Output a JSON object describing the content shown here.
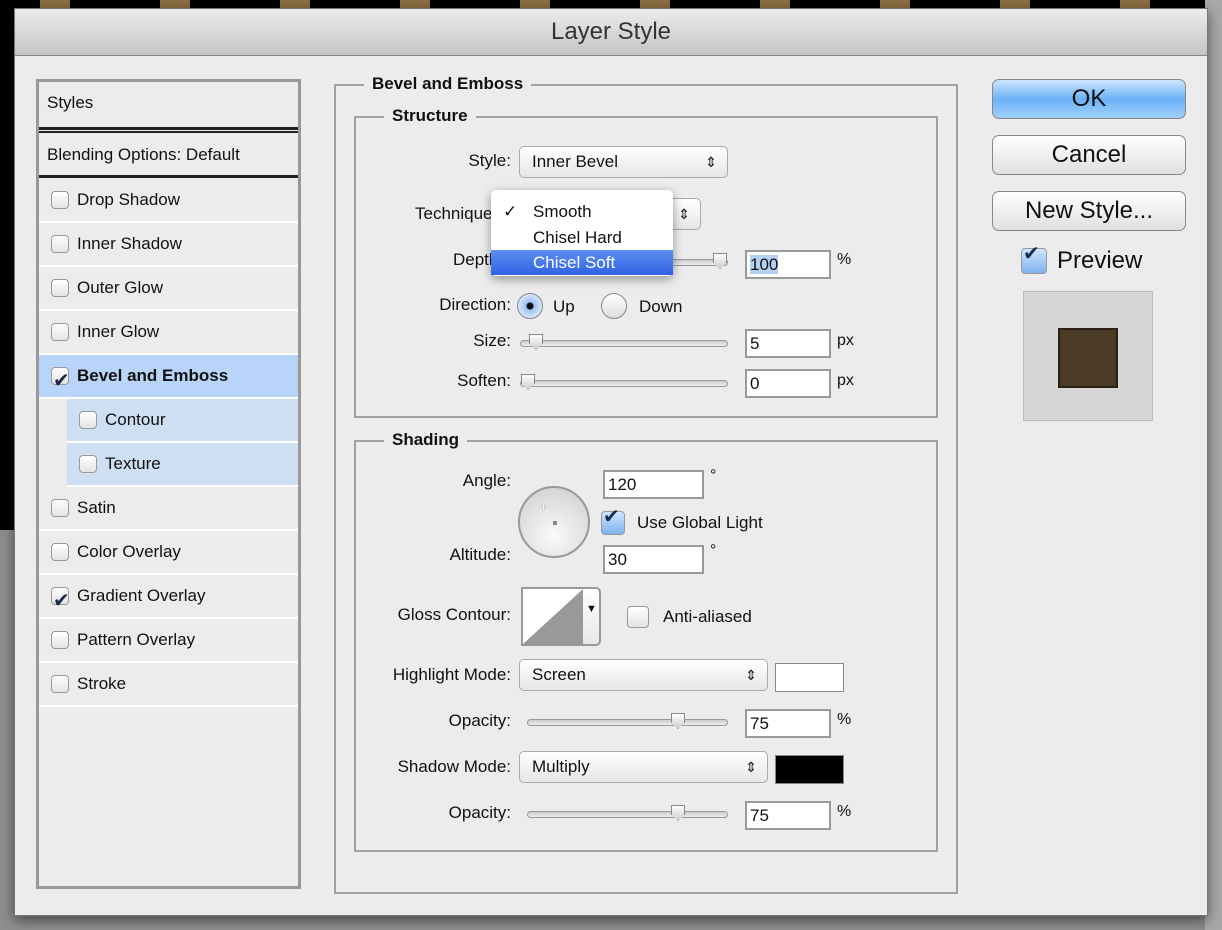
{
  "title": "Layer Style",
  "styles_panel": {
    "header": "Styles",
    "blending": "Blending Options: Default",
    "items": [
      {
        "label": "Drop Shadow",
        "checked": false
      },
      {
        "label": "Inner Shadow",
        "checked": false
      },
      {
        "label": "Outer Glow",
        "checked": false
      },
      {
        "label": "Inner Glow",
        "checked": false
      },
      {
        "label": "Bevel and Emboss",
        "checked": true,
        "selected": true
      },
      {
        "label": "Contour",
        "checked": false,
        "sub": true
      },
      {
        "label": "Texture",
        "checked": false,
        "sub": true
      },
      {
        "label": "Satin",
        "checked": false
      },
      {
        "label": "Color Overlay",
        "checked": false
      },
      {
        "label": "Gradient Overlay",
        "checked": true
      },
      {
        "label": "Pattern Overlay",
        "checked": false
      },
      {
        "label": "Stroke",
        "checked": false
      }
    ]
  },
  "bevel": {
    "title": "Bevel and Emboss",
    "structure": {
      "title": "Structure",
      "style_label": "Style:",
      "style_value": "Inner Bevel",
      "technique_label": "Technique:",
      "technique_menu": {
        "options": [
          "Smooth",
          "Chisel Hard",
          "Chisel Soft"
        ],
        "checked": "Smooth",
        "highlighted": "Chisel Soft",
        "check_mark": "✓"
      },
      "depth_label": "Depth:",
      "depth_value": "100",
      "depth_unit": "%",
      "direction_label": "Direction:",
      "dir_up": "Up",
      "dir_down": "Down",
      "direction": "Up",
      "size_label": "Size:",
      "size_value": "5",
      "size_unit": "px",
      "soften_label": "Soften:",
      "soften_value": "0",
      "soften_unit": "px"
    },
    "shading": {
      "title": "Shading",
      "angle_label": "Angle:",
      "angle_value": "120",
      "deg": "°",
      "global_light": "Use Global Light",
      "global_light_checked": true,
      "altitude_label": "Altitude:",
      "altitude_value": "30",
      "gloss_label": "Gloss Contour:",
      "anti_aliased": "Anti-aliased",
      "anti_aliased_checked": false,
      "highlight_label": "Highlight Mode:",
      "highlight_mode": "Screen",
      "highlight_color": "#ffffff",
      "opacity_label": "Opacity:",
      "highlight_opacity": "75",
      "pct": "%",
      "shadow_label": "Shadow Mode:",
      "shadow_mode": "Multiply",
      "shadow_color": "#000000",
      "shadow_opacity": "75"
    }
  },
  "buttons": {
    "ok": "OK",
    "cancel": "Cancel",
    "new_style": "New Style...",
    "preview": "Preview",
    "preview_checked": true
  },
  "preview_swatch_color": "#4a3a26"
}
